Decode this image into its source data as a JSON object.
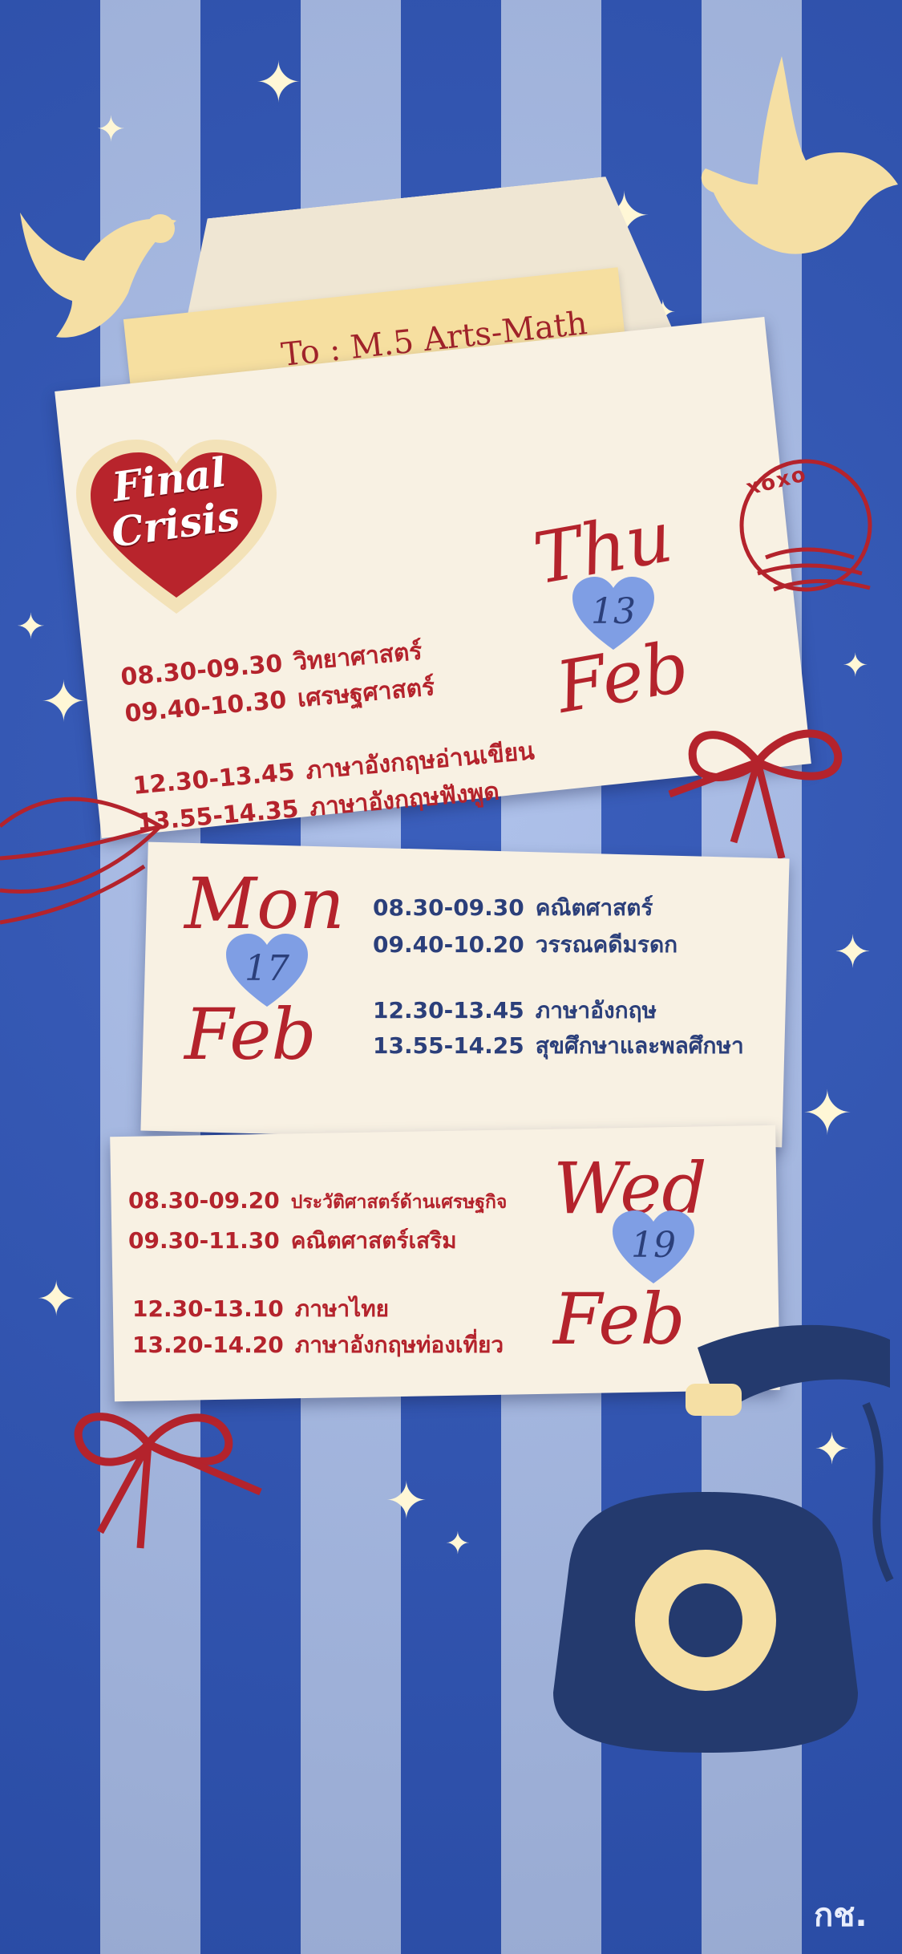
{
  "letter": {
    "to_label": "To : M.5 Arts-Math"
  },
  "badge": {
    "line1": "Final",
    "line2": "Crisis"
  },
  "stamp": {
    "text": "xoxo"
  },
  "days": [
    {
      "day": "Thu",
      "date": "13",
      "month": "Feb",
      "slots": [
        {
          "time": "08.30-09.30",
          "subject": "วิทยาศาสตร์"
        },
        {
          "time": "09.40-10.30",
          "subject": "เศรษฐศาสตร์"
        },
        {
          "time": "12.30-13.45",
          "subject": "ภาษาอังกฤษอ่านเขียน"
        },
        {
          "time": "13.55-14.35",
          "subject": "ภาษาอังกฤษฟังพูด"
        }
      ]
    },
    {
      "day": "Mon",
      "date": "17",
      "month": "Feb",
      "slots": [
        {
          "time": "08.30-09.30",
          "subject": "คณิตศาสตร์"
        },
        {
          "time": "09.40-10.20",
          "subject": "วรรณคดีมรดก"
        },
        {
          "time": "12.30-13.45",
          "subject": "ภาษาอังกฤษ"
        },
        {
          "time": "13.55-14.25",
          "subject": "สุขศึกษาและพลศึกษา"
        }
      ]
    },
    {
      "day": "Wed",
      "date": "19",
      "month": "Feb",
      "slots": [
        {
          "time": "08.30-09.20",
          "subject": "ประวัติศาสตร์ด้านเศรษฐกิจ"
        },
        {
          "time": "09.30-11.30",
          "subject": "คณิตศาสตร์เสริม"
        },
        {
          "time": "12.30-13.10",
          "subject": "ภาษาไทย"
        },
        {
          "time": "13.20-14.20",
          "subject": "ภาษาอังกฤษท่องเที่ยว"
        }
      ]
    }
  ],
  "logo": "กช.",
  "colors": {
    "stripe_dark": "#2f55b8",
    "stripe_light": "#a9bde9",
    "red": "#b4232c",
    "navy": "#2b3f7a",
    "paper": "#f8f1e3",
    "gold": "#f6dfa0"
  }
}
